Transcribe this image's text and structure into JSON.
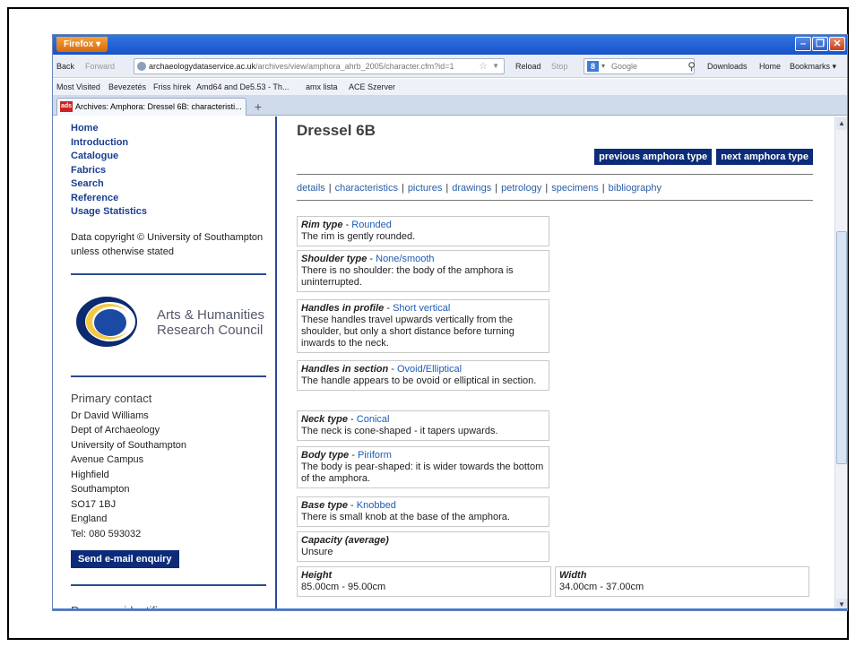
{
  "browser": {
    "app_button": "Firefox ▾",
    "nav": {
      "back": "Back",
      "forward": "Forward",
      "url_domain": "archaeologydataservice.ac.uk",
      "url_path": "/archives/view/amphora_ahrb_2005/character.cfm?id=1",
      "reload": "Reload",
      "stop": "Stop",
      "search_placeholder": "Google",
      "downloads": "Downloads",
      "home": "Home",
      "bookmarks": "Bookmarks ▾"
    },
    "bookmarks": [
      "Most Visited",
      "Bevezetés",
      "Friss hírek",
      "Amd64 and De5.53 - Th...",
      "amx lista",
      "ACE Szerver"
    ],
    "tab_title": "Archives: Amphora: Dressel 6B: characteristi...",
    "tab_icon_text": "ads"
  },
  "sidebar": {
    "nav": [
      "Home",
      "Introduction",
      "Catalogue",
      "Fabrics",
      "Search",
      "Reference",
      "Usage Statistics"
    ],
    "copyright": "Data copyright © University of Southampton unless otherwise stated",
    "logo_line1": "Arts & Humanities",
    "logo_line2": "Research Council",
    "contact_title": "Primary contact",
    "address": [
      "Dr David Williams",
      "Dept of Archaeology",
      "University of Southampton",
      "Avenue Campus",
      "Highfield",
      "Southampton",
      "SO17 1BJ",
      "England",
      "Tel: 080 593032"
    ],
    "send_button": "Send e-mail enquiry",
    "resource_title": "Resource identifiers"
  },
  "main": {
    "title": "Dressel 6B",
    "prev_button": "previous amphora type",
    "next_button": "next amphora type",
    "tabs": [
      "details",
      "characteristics",
      "pictures",
      "drawings",
      "petrology",
      "specimens",
      "bibliography"
    ],
    "characteristics": [
      {
        "label": "Rim type",
        "value": "Rounded",
        "description": "The rim is gently rounded."
      },
      {
        "label": "Shoulder type",
        "value": "None/smooth",
        "description": "There is no shoulder: the body of the amphora is uninterrupted."
      },
      {
        "label": "Handles in profile",
        "value": "Short vertical",
        "description": "These handles travel upwards vertically from the shoulder, but only a short distance before turning inwards to the neck."
      },
      {
        "label": "Handles in section",
        "value": "Ovoid/Elliptical",
        "description": "The handle appears to be ovoid or elliptical in section."
      },
      {
        "label": "Neck type",
        "value": "Conical",
        "description": "The neck is cone-shaped - it tapers upwards."
      },
      {
        "label": "Body type",
        "value": "Piriform",
        "description": "The body is pear-shaped: it is wider towards the bottom of the amphora."
      },
      {
        "label": "Base type",
        "value": "Knobbed",
        "description": "There is small knob at the base of the amphora."
      },
      {
        "label": "Capacity (average)",
        "value": "",
        "description": "Unsure"
      }
    ],
    "height": {
      "label": "Height",
      "value": "85.00cm - 95.00cm"
    },
    "width": {
      "label": "Width",
      "value": "34.00cm - 37.00cm"
    }
  },
  "colors": {
    "accent": "#0c2b78",
    "link": "#1a3f8f",
    "titlebar": "#2f76e0"
  }
}
